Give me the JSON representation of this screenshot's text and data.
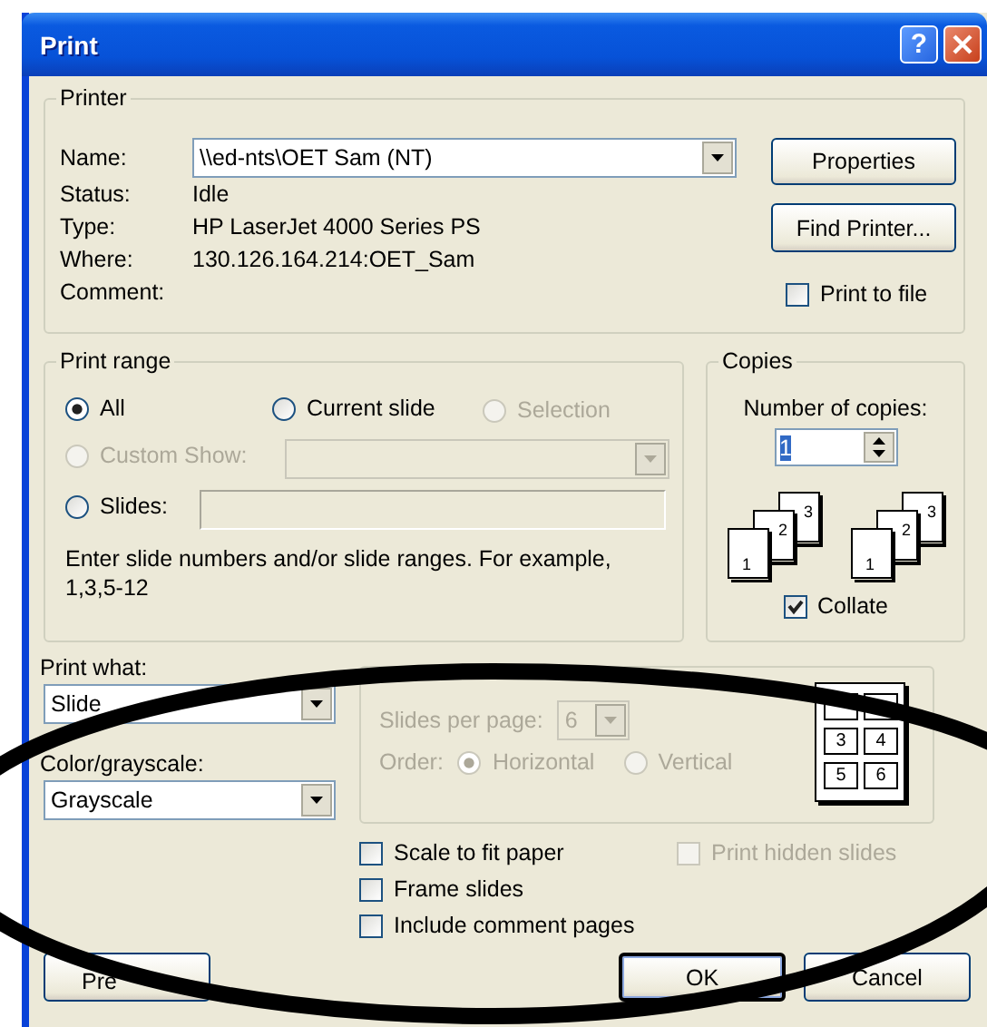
{
  "window": {
    "title": "Print",
    "help_button": "?"
  },
  "printer": {
    "group_label": "Printer",
    "name_label": "Name:",
    "name_value": "\\\\ed-nts\\OET Sam (NT)",
    "details": [
      {
        "label": "Status:",
        "value": "Idle"
      },
      {
        "label": "Type:",
        "value": "HP LaserJet 4000 Series PS"
      },
      {
        "label": "Where:",
        "value": "130.126.164.214:OET_Sam"
      },
      {
        "label": "Comment:"
      }
    ],
    "buttons": [
      "Properties",
      "Find Printer..."
    ],
    "print_to_file": {
      "label": "Print to file",
      "checked": false
    }
  },
  "print_range": {
    "group_label": "Print range",
    "options": [
      {
        "label": "All",
        "selected": true,
        "disabled": false
      },
      {
        "label": "Current slide",
        "selected": false,
        "disabled": false
      },
      {
        "label": "Selection",
        "selected": false,
        "disabled": true
      },
      {
        "label": "Custom Show:",
        "selected": false,
        "disabled": true
      },
      {
        "label": "Slides:",
        "selected": false,
        "disabled": false
      }
    ],
    "hint": "Enter slide numbers and/or slide ranges. For example, 1,3,5-12"
  },
  "copies": {
    "group_label": "Copies",
    "count_label": "Number of copies:",
    "count_value": "1",
    "stacks": [
      {
        "pages": [
          "1",
          "2",
          "3"
        ]
      },
      {
        "pages": [
          "1",
          "2",
          "3"
        ]
      }
    ],
    "collate": {
      "label": "Collate",
      "checked": true
    }
  },
  "print_what": {
    "label": "Print what:",
    "value": "Slide"
  },
  "color": {
    "label": "Color/grayscale:",
    "value": "Grayscale"
  },
  "handouts": {
    "disabled": true,
    "per_page_label": "Slides per page:",
    "per_page_value": "6",
    "order_label": "Order:",
    "orders": [
      {
        "label": "Horizontal",
        "selected": true
      },
      {
        "label": "Vertical",
        "selected": false
      }
    ],
    "preview_pages": [
      "3",
      "4",
      "5",
      "6"
    ]
  },
  "options": [
    {
      "label": "Scale to fit paper",
      "checked": false,
      "disabled": false
    },
    {
      "label": "Print hidden slides",
      "checked": false,
      "disabled": true
    },
    {
      "label": "Frame slides",
      "checked": false,
      "disabled": false
    },
    {
      "label": "Include comment pages",
      "checked": false,
      "disabled": false
    }
  ],
  "buttons": [
    {
      "label": "Pre",
      "default": false
    },
    {
      "label": "OK",
      "default": true
    },
    {
      "label": "Cancel",
      "default": false
    }
  ]
}
